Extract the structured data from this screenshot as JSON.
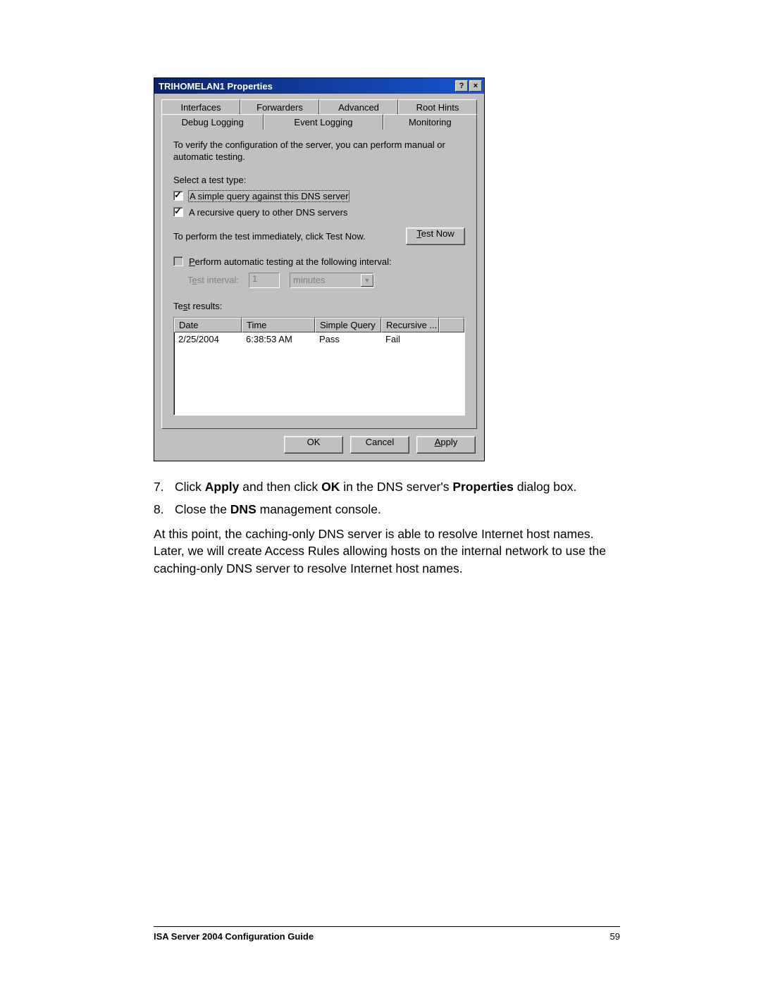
{
  "dialog": {
    "title": "TRIHOMELAN1 Properties",
    "tabs_back": [
      "Interfaces",
      "Forwarders",
      "Advanced",
      "Root Hints"
    ],
    "tabs_front": [
      "Debug Logging",
      "Event Logging",
      "Monitoring"
    ],
    "description": "To verify the configuration of the server, you can perform manual or automatic testing.",
    "select_label": "Select a test type:",
    "cb_simple": "A simple query against this DNS server",
    "cb_recursive": "A recursive query to other DNS servers",
    "perform_text": "To perform the test immediately, click Test Now.",
    "test_now_btn": "Test Now",
    "cb_auto": "Perform automatic testing at the following interval:",
    "interval_label": "Test interval:",
    "interval_value": "1",
    "interval_units": "minutes",
    "results_label": "Test results:",
    "columns": {
      "date": "Date",
      "time": "Time",
      "simple": "Simple Query",
      "recursive": "Recursive ..."
    },
    "row": {
      "date": "2/25/2004",
      "time": "6:38:53 AM",
      "simple": "Pass",
      "recursive": "Fail"
    },
    "ok": "OK",
    "cancel": "Cancel",
    "apply": "Apply"
  },
  "doc": {
    "item7_num": "7.",
    "item7_pre": "Click ",
    "item7_b1": "Apply",
    "item7_mid": " and then click ",
    "item7_b2": "OK",
    "item7_mid2": " in the DNS server's ",
    "item7_b3": "Properties",
    "item7_post": " dialog box.",
    "item8_num": "8.",
    "item8_pre": "Close the ",
    "item8_b1": "DNS",
    "item8_post": " management console.",
    "para": "At this point, the caching-only DNS server is able to resolve Internet host names. Later, we will create Access Rules allowing hosts on the internal network to use the caching-only DNS server to resolve Internet host names."
  },
  "footer": {
    "left": "ISA Server 2004 Configuration Guide",
    "right": "59"
  }
}
